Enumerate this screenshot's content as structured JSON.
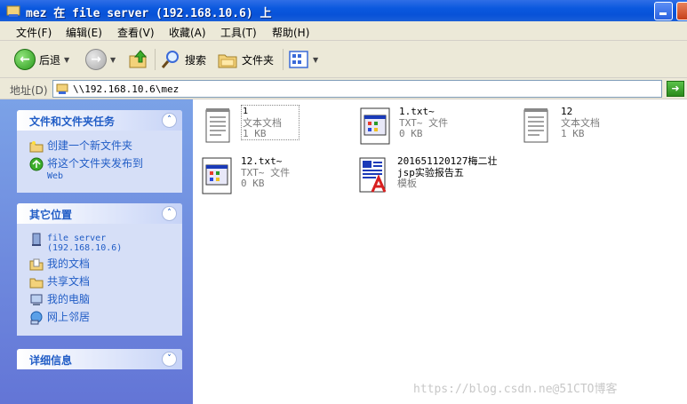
{
  "window": {
    "title": "mez 在 file server (192.168.10.6) 上"
  },
  "menu": [
    "文件(F)",
    "编辑(E)",
    "查看(V)",
    "收藏(A)",
    "工具(T)",
    "帮助(H)"
  ],
  "toolbar": {
    "back_label": "后退",
    "search_label": "搜索",
    "folders_label": "文件夹"
  },
  "address": {
    "label": "地址(D)",
    "value": "\\\\192.168.10.6\\mez"
  },
  "tasks_panel": {
    "title": "文件和文件夹任务",
    "items": [
      "创建一个新文件夹",
      "将这个文件夹发布到",
      "Web"
    ]
  },
  "places_panel": {
    "title": "其它位置",
    "items": [
      "file server",
      "(192.168.10.6)",
      "我的文档",
      "共享文档",
      "我的电脑",
      "网上邻居"
    ]
  },
  "details_panel": {
    "title": "详细信息"
  },
  "files": [
    {
      "name": "1",
      "type": "文本文档",
      "size": "1 KB",
      "icon": "text-document-icon"
    },
    {
      "name": "1.txt~",
      "type": "TXT~ 文件",
      "size": "0 KB",
      "icon": "unknown-file-icon"
    },
    {
      "name": "12",
      "type": "文本文档",
      "size": "1 KB",
      "icon": "text-document-icon"
    },
    {
      "name": "12.txt~",
      "type": "TXT~ 文件",
      "size": "0 KB",
      "icon": "unknown-file-icon"
    },
    {
      "name": "201651120127梅二壮",
      "name2": "jsp实验报告五",
      "type": "模板",
      "icon": "word-template-icon"
    }
  ],
  "watermark": "https://blog.csdn.ne@51CTO博客"
}
